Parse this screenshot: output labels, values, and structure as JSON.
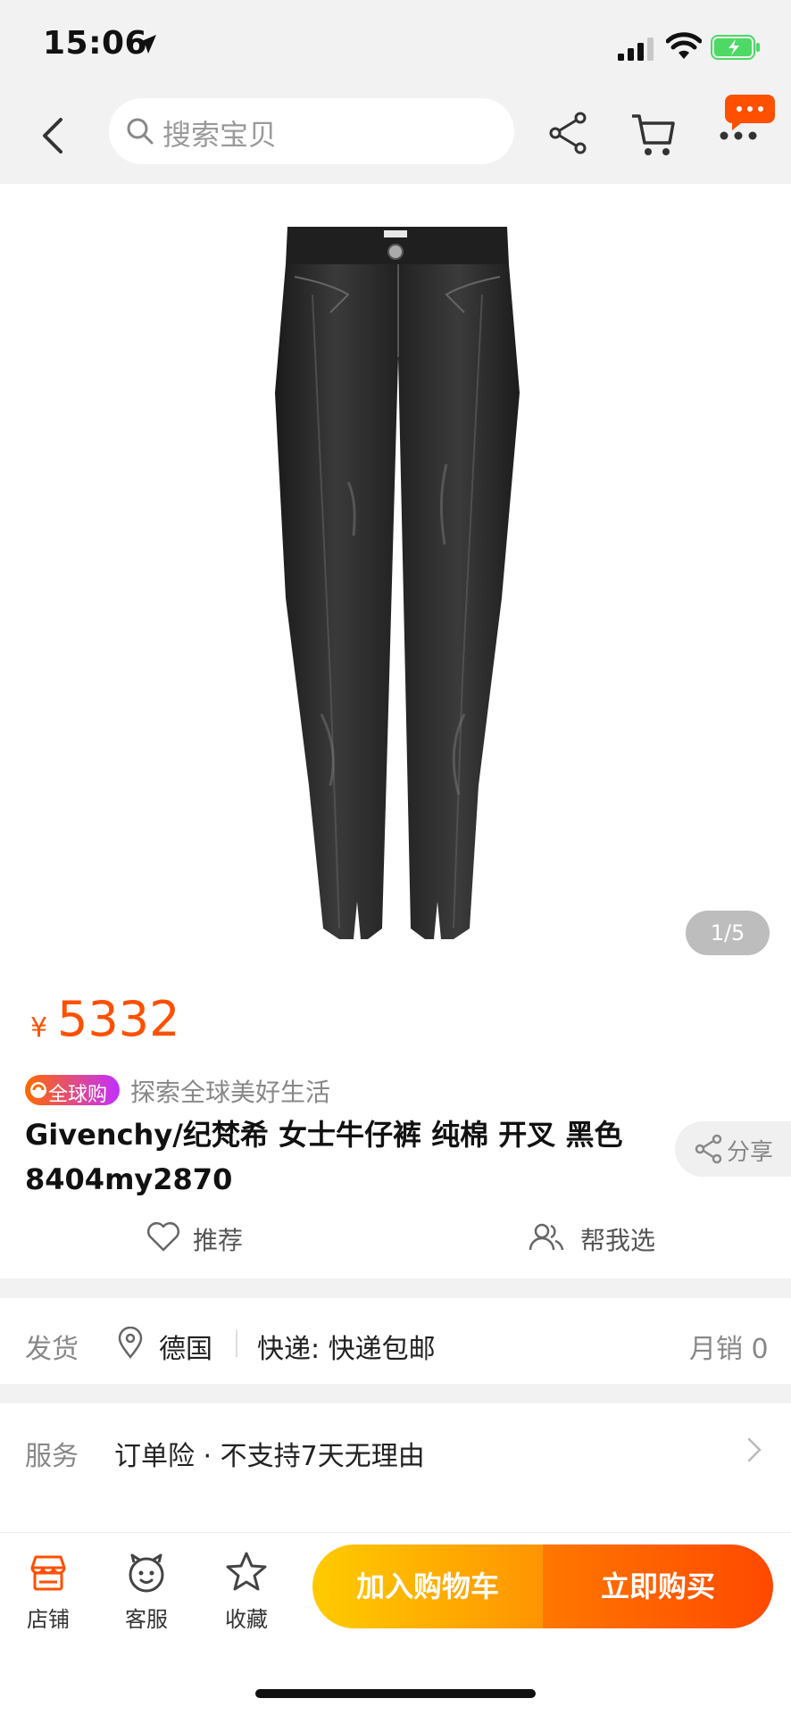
{
  "status_bar": {
    "time": "15:06"
  },
  "nav": {
    "search_placeholder": "搜索宝贝"
  },
  "product": {
    "image_counter": "1/5",
    "price_symbol": "¥",
    "price": "5332",
    "global_badge": "全球购",
    "slogan": "探索全球美好生活",
    "title": "Givenchy/纪梵希 女士牛仔裤 纯棉 开叉 黑色 8404my2870",
    "share_label": "分享",
    "recommend_label": "推荐",
    "help_choose_label": "帮我选"
  },
  "shipping": {
    "label": "发货",
    "origin": "德国",
    "express": "快递: 快递包邮",
    "monthly_sales": "月销 0"
  },
  "service": {
    "label": "服务",
    "text": "订单险 · 不支持7天无理由"
  },
  "bottom_bar": {
    "shop_label": "店铺",
    "service_label": "客服",
    "favorite_label": "收藏",
    "add_to_cart": "加入购物车",
    "buy_now": "立即购买"
  },
  "colors": {
    "accent": "#ff5000",
    "cart_gradient": [
      "#ffcb00",
      "#ff9402"
    ],
    "buy_gradient": [
      "#ff7700",
      "#ff4900"
    ]
  },
  "icons": [
    "back-icon",
    "search-icon",
    "share-icon",
    "cart-icon",
    "more-icon",
    "message-badge",
    "location-pin-icon",
    "heart-icon",
    "people-icon",
    "shop-icon",
    "customer-service-icon",
    "star-icon",
    "chevron-right-icon"
  ]
}
